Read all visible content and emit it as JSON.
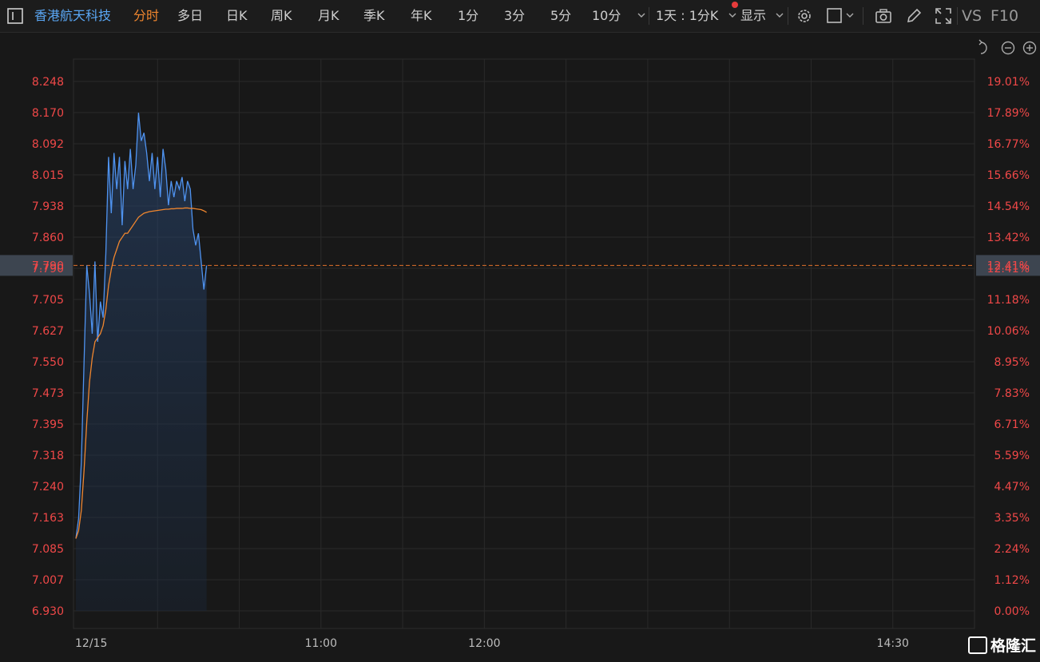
{
  "toolbar": {
    "stock_name": "香港航天科技",
    "periods": [
      "分时",
      "多日",
      "日K",
      "周K",
      "月K",
      "季K",
      "年K",
      "1分",
      "3分",
      "5分",
      "10分"
    ],
    "active_period": "分时",
    "interval_select": "1天 : 1分K",
    "display_label": "显示",
    "vs_label": "VS",
    "f10_label": "F10"
  },
  "colors": {
    "price_line": "#4f93f0",
    "avg_line": "#f0862e",
    "axis_label_red": "#f04848",
    "ref_line": "#e0702a",
    "accent_active": "#f0862e",
    "stock_name": "#5aa7f5"
  },
  "chart_data": {
    "type": "line",
    "y_ticks": [
      "8.248",
      "8.170",
      "8.092",
      "8.015",
      "7.938",
      "7.860",
      "7.790",
      "7.705",
      "7.627",
      "7.550",
      "7.473",
      "7.395",
      "7.318",
      "7.240",
      "7.163",
      "7.085",
      "7.007",
      "6.930"
    ],
    "pct_ticks": [
      "19.01%",
      "17.89%",
      "16.77%",
      "15.66%",
      "14.54%",
      "13.42%",
      "12.41%",
      "11.18%",
      "10.06%",
      "8.95%",
      "7.83%",
      "6.71%",
      "5.59%",
      "4.47%",
      "3.35%",
      "2.24%",
      "1.12%",
      "0.00%"
    ],
    "ylim": [
      6.93,
      8.248
    ],
    "x_labels": [
      "12/15",
      "11:00",
      "12:00",
      "14:30"
    ],
    "x_label_minutes": [
      0,
      90,
      150,
      300
    ],
    "session_minutes": 330,
    "current_price": "7.790",
    "current_pct": "12.41%",
    "series": [
      {
        "values": [
          7.11,
          7.16,
          7.3,
          7.55,
          7.79,
          7.72,
          7.62,
          7.8,
          7.6,
          7.7,
          7.66,
          7.82,
          8.06,
          7.92,
          8.07,
          7.98,
          8.06,
          7.89,
          8.05,
          7.98,
          8.08,
          7.98,
          8.04,
          8.17,
          8.1,
          8.12,
          8.07,
          8.0,
          8.07,
          7.98,
          8.06,
          7.96,
          8.08,
          8.03,
          7.94,
          8.0,
          7.96,
          8.0,
          7.98,
          8.01,
          7.95,
          8.0,
          7.98,
          7.88,
          7.84,
          7.87,
          7.8,
          7.73,
          7.79
        ]
      },
      {
        "values": [
          7.11,
          7.13,
          7.18,
          7.28,
          7.4,
          7.5,
          7.56,
          7.6,
          7.61,
          7.62,
          7.64,
          7.68,
          7.74,
          7.78,
          7.81,
          7.83,
          7.85,
          7.86,
          7.87,
          7.87,
          7.88,
          7.89,
          7.9,
          7.91,
          7.915,
          7.92,
          7.922,
          7.924,
          7.925,
          7.926,
          7.927,
          7.928,
          7.929,
          7.93,
          7.93,
          7.931,
          7.931,
          7.932,
          7.932,
          7.932,
          7.933,
          7.933,
          7.932,
          7.932,
          7.931,
          7.93,
          7.929,
          7.926,
          7.922
        ]
      }
    ]
  }
}
